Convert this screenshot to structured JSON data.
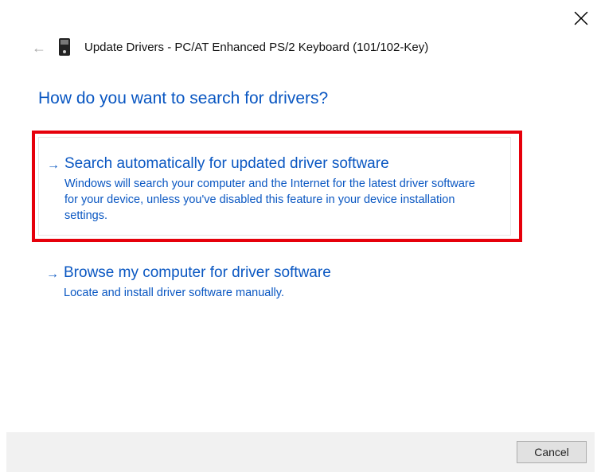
{
  "window": {
    "title_prefix": "Update Drivers",
    "device_name": "PC/AT Enhanced PS/2 Keyboard (101/102-Key)"
  },
  "heading": "How do you want to search for drivers?",
  "options": [
    {
      "title": "Search automatically for updated driver software",
      "description": "Windows will search your computer and the Internet for the latest driver software for your device, unless you've disabled this feature in your device installation settings.",
      "highlighted": true
    },
    {
      "title": "Browse my computer for driver software",
      "description": "Locate and install driver software manually.",
      "highlighted": false
    }
  ],
  "buttons": {
    "cancel": "Cancel"
  }
}
